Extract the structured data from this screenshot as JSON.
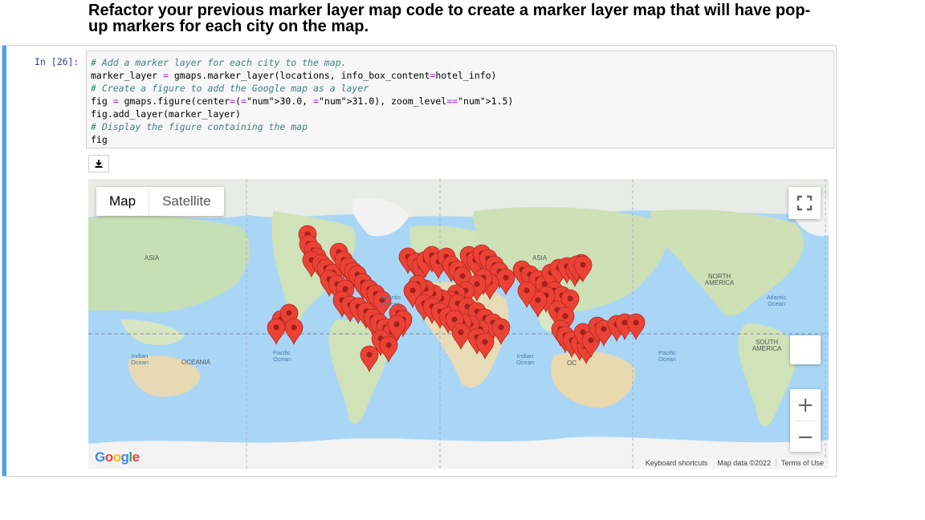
{
  "heading": "Refactor your previous marker layer map code to create a marker layer map that will have pop-up markers for each city on the map.",
  "cell": {
    "prompt": "In [26]:",
    "code_lines": [
      {
        "type": "comment",
        "text": "# Add a marker layer for each city to the map."
      },
      {
        "type": "code",
        "text": "marker_layer = gmaps.marker_layer(locations, info_box_content=hotel_info)"
      },
      {
        "type": "comment",
        "text": "# Create a figure to add the Google map as a layer"
      },
      {
        "type": "code",
        "text": "fig = gmaps.figure(center=(30.0, 31.0), zoom_level=1.5)"
      },
      {
        "type": "code",
        "text": "fig.add_layer(marker_layer)"
      },
      {
        "type": "comment",
        "text": "# Display the figure containing the map"
      },
      {
        "type": "code",
        "text": "fig"
      }
    ]
  },
  "toolbar": {
    "download_icon": "download-icon"
  },
  "map": {
    "type_control": {
      "map": "Map",
      "satellite": "Satellite",
      "selected": "Map"
    },
    "zoom_in": "+",
    "zoom_out": "−",
    "logo": "Google",
    "attribution": {
      "shortcuts": "Keyboard shortcuts",
      "data": "Map data ©2022",
      "terms": "Terms of Use"
    },
    "labels": {
      "asia_left": "ASIA",
      "asia_right": "ASIA",
      "north_america": "NORTH AMERICA",
      "south_america": "SOUTH AMERICA",
      "oceania": "OCEANIA",
      "atlantic_left": "Atlantic Ocean",
      "atlantic_right": "Atlantic Ocean",
      "indian_left": "Indian Ocean",
      "indian_right": "Indian Ocean",
      "pacific_left": "Pacific Ocean",
      "pacific_right": "Pacific Ocean",
      "oc_partial": "OC"
    },
    "marker_color": "#ea4335"
  }
}
